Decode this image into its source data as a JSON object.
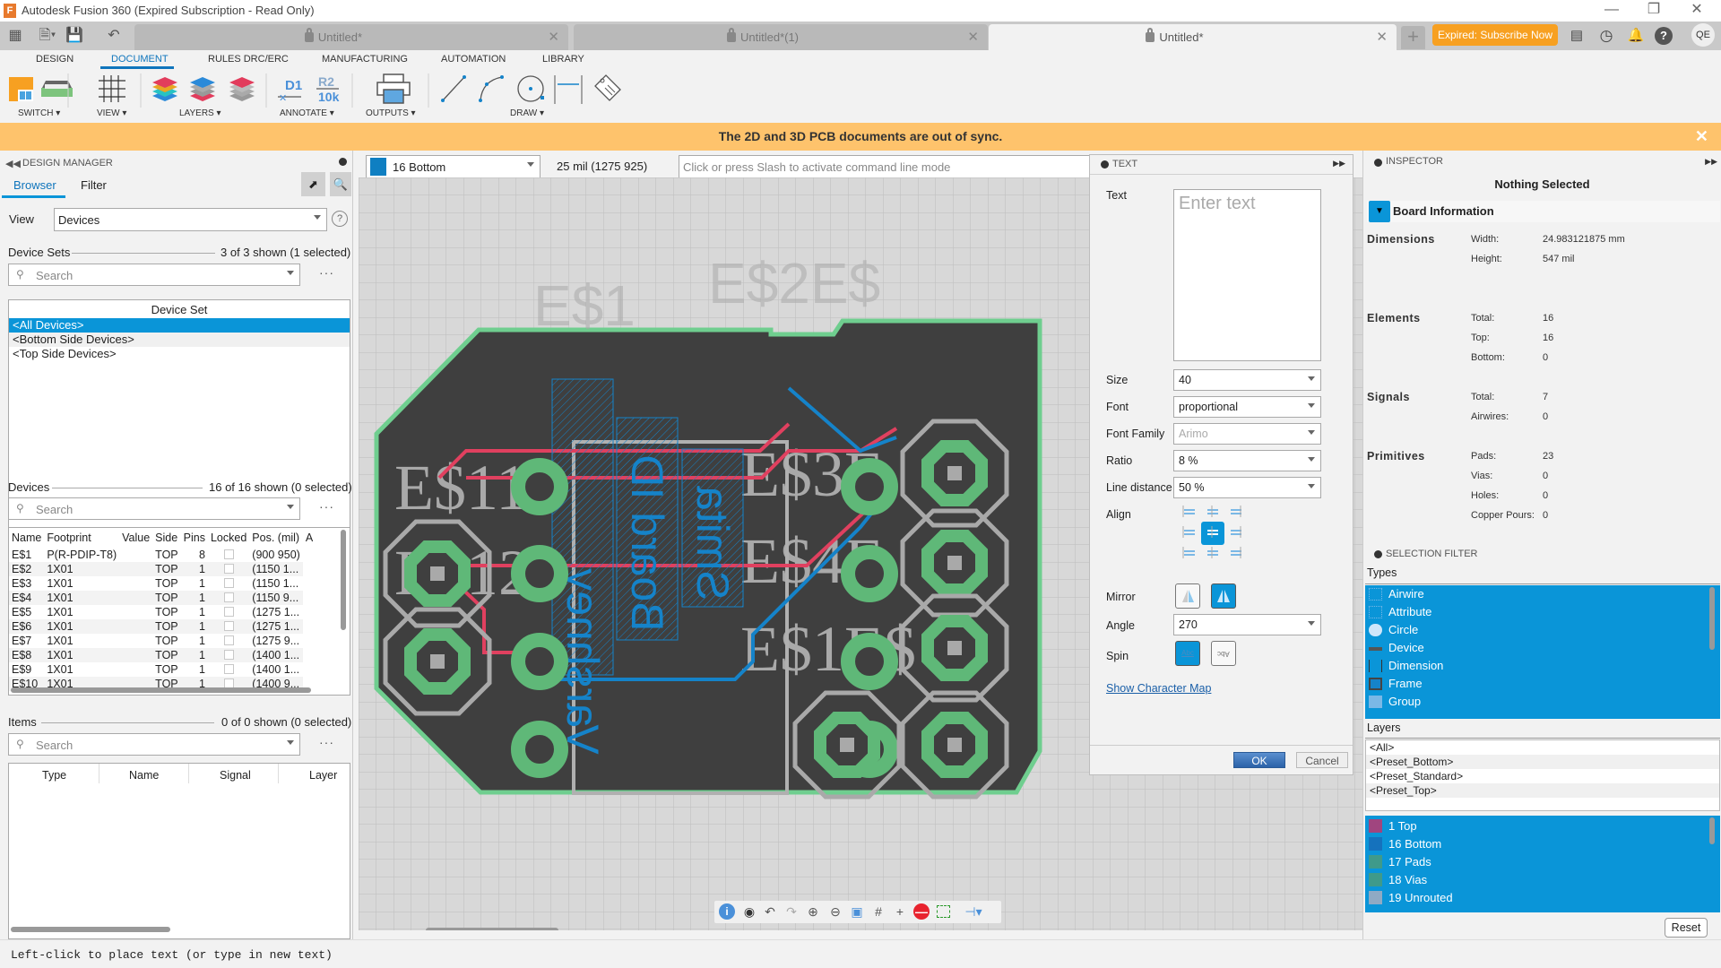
{
  "window": {
    "title": "Autodesk Fusion 360 (Expired Subscription - Read Only)",
    "logo": "F",
    "controls": [
      "minimize-icon",
      "restore-icon",
      "close-icon"
    ]
  },
  "tabs": [
    {
      "label": "Untitled*",
      "active": false
    },
    {
      "label": "Untitled*(1)",
      "active": false
    },
    {
      "label": "Untitled*",
      "active": true
    }
  ],
  "topbar": {
    "subscribe_label": "Expired: Subscribe Now",
    "avatar": "QE",
    "icons": [
      "comments-icon",
      "job-status-icon",
      "notifications-icon",
      "help-icon"
    ]
  },
  "ribbon": {
    "tabs": [
      "DESIGN",
      "DOCUMENT",
      "RULES DRC/ERC",
      "MANUFACTURING",
      "AUTOMATION",
      "LIBRARY"
    ],
    "active_tab": "DOCUMENT",
    "groups": [
      "SWITCH",
      "VIEW",
      "LAYERS",
      "ANNOTATE",
      "OUTPUTS",
      "DRAW"
    ],
    "annotate_labels": {
      "d1": "D1",
      "r2": "R2",
      "r2val": "10k"
    }
  },
  "banner": {
    "message": "The 2D and 3D PCB documents are out of sync."
  },
  "design_manager": {
    "title": "DESIGN MANAGER",
    "tabs": [
      "Browser",
      "Filter"
    ],
    "active_tab": "Browser",
    "view_label": "View",
    "view_value": "Devices",
    "device_sets": {
      "title": "Device Sets",
      "count": "3 of 3 shown (1 selected)",
      "search_placeholder": "Search",
      "column": "Device Set",
      "rows": [
        "<All Devices>",
        "<Bottom Side Devices>",
        "<Top Side Devices>"
      ],
      "selected_index": 0
    },
    "devices": {
      "title": "Devices",
      "count": "16 of 16 shown (0 selected)",
      "search_placeholder": "Search",
      "columns": [
        "Name",
        "Footprint",
        "Value",
        "Side",
        "Pins",
        "Locked",
        "Pos. (mil)",
        "A"
      ],
      "rows": [
        {
          "name": "E$1",
          "footprint": "P(R-PDIP-T8)",
          "value": "",
          "side": "TOP",
          "pins": "8",
          "locked": false,
          "pos": "(900 950)"
        },
        {
          "name": "E$2",
          "footprint": "1X01",
          "value": "",
          "side": "TOP",
          "pins": "1",
          "locked": false,
          "pos": "(1150 1..."
        },
        {
          "name": "E$3",
          "footprint": "1X01",
          "value": "",
          "side": "TOP",
          "pins": "1",
          "locked": false,
          "pos": "(1150 1..."
        },
        {
          "name": "E$4",
          "footprint": "1X01",
          "value": "",
          "side": "TOP",
          "pins": "1",
          "locked": false,
          "pos": "(1150 9..."
        },
        {
          "name": "E$5",
          "footprint": "1X01",
          "value": "",
          "side": "TOP",
          "pins": "1",
          "locked": false,
          "pos": "(1275 1..."
        },
        {
          "name": "E$6",
          "footprint": "1X01",
          "value": "",
          "side": "TOP",
          "pins": "1",
          "locked": false,
          "pos": "(1275 1..."
        },
        {
          "name": "E$7",
          "footprint": "1X01",
          "value": "",
          "side": "TOP",
          "pins": "1",
          "locked": false,
          "pos": "(1275 9..."
        },
        {
          "name": "E$8",
          "footprint": "1X01",
          "value": "",
          "side": "TOP",
          "pins": "1",
          "locked": false,
          "pos": "(1400 1..."
        },
        {
          "name": "E$9",
          "footprint": "1X01",
          "value": "",
          "side": "TOP",
          "pins": "1",
          "locked": false,
          "pos": "(1400 1..."
        },
        {
          "name": "E$10",
          "footprint": "1X01",
          "value": "",
          "side": "TOP",
          "pins": "1",
          "locked": false,
          "pos": "(1400 9..."
        }
      ]
    },
    "items": {
      "title": "Items",
      "count": "0 of 0 shown (0 selected)",
      "search_placeholder": "Search",
      "columns": [
        "Type",
        "Name",
        "Signal",
        "Layer"
      ]
    }
  },
  "canvas_bar": {
    "layer": "16 Bottom",
    "layer_color": "#0f7fc2",
    "coords": "25 mil (1275 925)",
    "command_placeholder": "Click or press Slash to activate command line mode"
  },
  "canvas": {
    "labels": [
      "E$1",
      "E$2E$",
      "E$11",
      "E$12",
      "E$3E",
      "E$4E",
      "E$1E$"
    ],
    "bottom_text": [
      "Varshney",
      "Board ID",
      "Smita"
    ],
    "toolbar": [
      "info-icon",
      "display-icon",
      "undo-icon",
      "redo-icon",
      "zoom-in-icon",
      "zoom-out-icon",
      "zoom-fit-icon",
      "grid-icon",
      "crosshair-icon",
      "stop-icon",
      "select-window-icon",
      "route-icon"
    ]
  },
  "text_dialog": {
    "title": "TEXT",
    "text_label": "Text",
    "text_placeholder": "Enter text",
    "fields": [
      {
        "label": "Size",
        "value": "40",
        "disabled": false
      },
      {
        "label": "Font",
        "value": "proportional",
        "disabled": false
      },
      {
        "label": "Font Family",
        "value": "Arimo",
        "disabled": true
      },
      {
        "label": "Ratio",
        "value": "8 %",
        "disabled": false
      },
      {
        "label": "Line distance",
        "value": "50 %",
        "disabled": false
      }
    ],
    "align_label": "Align",
    "align_selected": "center-middle",
    "mirror_label": "Mirror",
    "mirror_selected": "on",
    "angle_label": "Angle",
    "angle_value": "270",
    "spin_label": "Spin",
    "spin_selected": "off",
    "spin_options": [
      "Abc",
      "Abc"
    ],
    "char_map_link": "Show Character Map",
    "ok_label": "OK",
    "cancel_label": "Cancel"
  },
  "inspector": {
    "title": "INSPECTOR",
    "status": "Nothing Selected",
    "section": "Board Information",
    "groups": [
      {
        "name": "Dimensions",
        "items": [
          {
            "k": "Width:",
            "v": "24.983121875 mm"
          },
          {
            "k": "Height:",
            "v": "547 mil"
          }
        ]
      },
      {
        "name": "Elements",
        "items": [
          {
            "k": "Total:",
            "v": "16"
          },
          {
            "k": "Top:",
            "v": "16"
          },
          {
            "k": "Bottom:",
            "v": "0"
          }
        ]
      },
      {
        "name": "Signals",
        "items": [
          {
            "k": "Total:",
            "v": "7"
          },
          {
            "k": "Airwires:",
            "v": "0"
          }
        ]
      },
      {
        "name": "Primitives",
        "items": [
          {
            "k": "Pads:",
            "v": "23"
          },
          {
            "k": "Vias:",
            "v": "0"
          },
          {
            "k": "Holes:",
            "v": "0"
          },
          {
            "k": "Copper Pours:",
            "v": "0"
          }
        ]
      }
    ]
  },
  "selection_filter": {
    "title": "SELECTION FILTER",
    "types_label": "Types",
    "types": [
      "Airwire",
      "Attribute",
      "Circle",
      "Device",
      "Dimension",
      "Frame",
      "Group"
    ],
    "layers_label": "Layers",
    "presets": [
      "<All>",
      "<Preset_Bottom>",
      "<Preset_Standard>",
      "<Preset_Top>"
    ],
    "layers": [
      {
        "label": "1 Top",
        "color": "#a0457f"
      },
      {
        "label": "16 Bottom",
        "color": "#1572bd"
      },
      {
        "label": "17 Pads",
        "color": "#3f9a8a"
      },
      {
        "label": "18 Vias",
        "color": "#3f9a8a"
      },
      {
        "label": "19 Unrouted",
        "color": "#8faac4"
      }
    ],
    "reset_label": "Reset"
  },
  "status": {
    "message": "Left-click to place text (or type in new text)"
  },
  "colors": {
    "accent": "#0a95d8",
    "banner": "#fec36c",
    "subscribe": "#f7a021",
    "board": "#3f3f3f",
    "outline": "#6fce8f",
    "top_trace": "#e0405f",
    "bottom_trace": "#1583c9"
  }
}
